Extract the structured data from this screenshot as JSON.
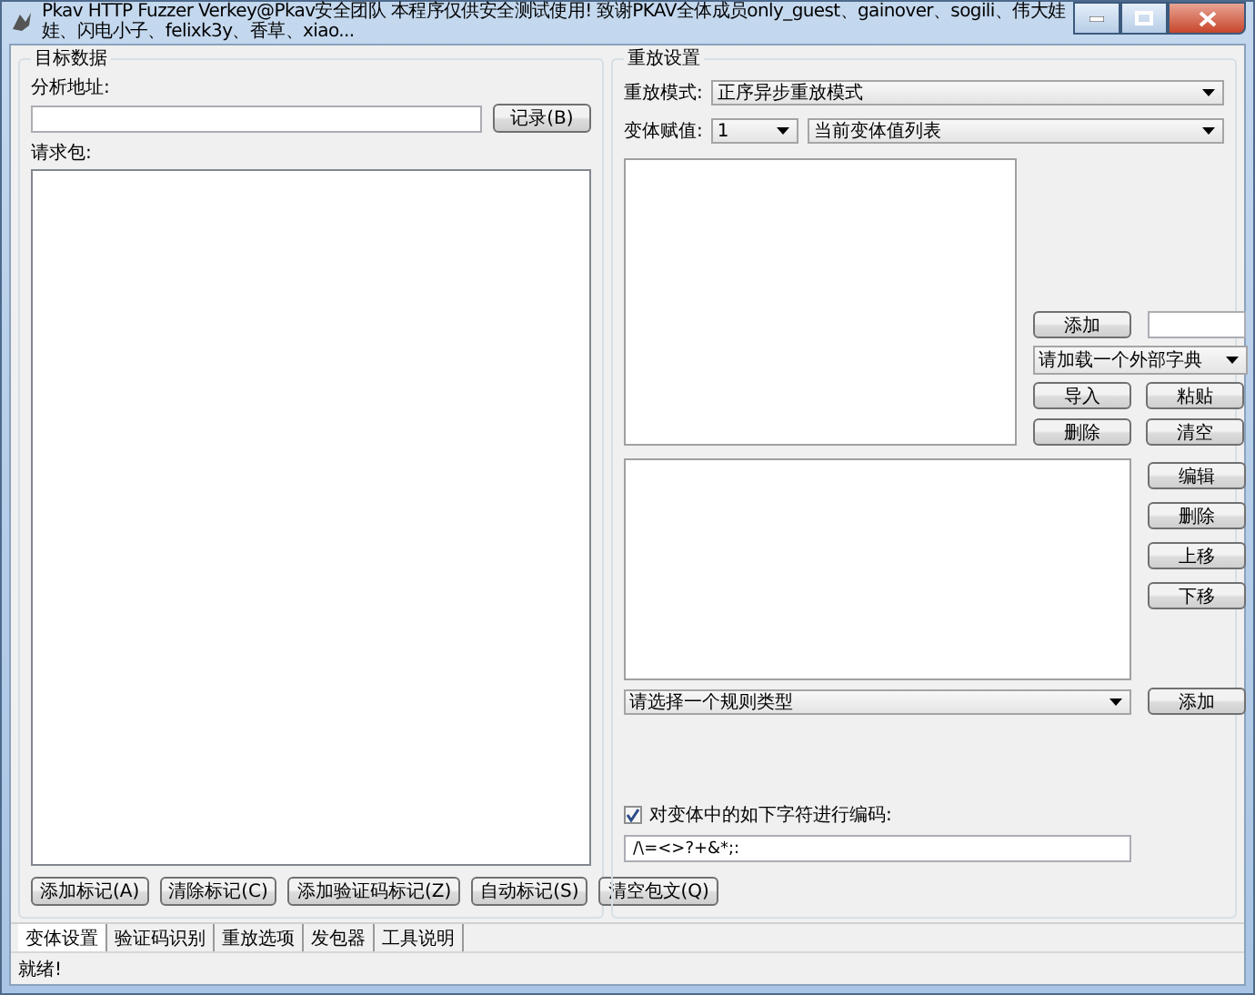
{
  "window": {
    "title": "Pkav HTTP Fuzzer   Verkey@Pkav安全团队  本程序仅供安全测试使用! 致谢PKAV全体成员only_guest、gainover、sogili、伟大娃娃、闪电小子、felixk3y、香草、xiao..."
  },
  "target": {
    "title": "目标数据",
    "url_label": "分析地址:",
    "record_button": "记录(B)",
    "request_label": "请求包:",
    "buttons": [
      "添加标记(A)",
      "清除标记(C)",
      "添加验证码标记(Z)",
      "自动标记(S)",
      "清空包文(Q)"
    ]
  },
  "replay": {
    "title": "重放设置",
    "mode_label": "重放模式:",
    "mode_value": "正序异步重放模式",
    "assign_label": "变体赋值:",
    "assign_value": "1",
    "list_value": "当前变体值列表",
    "add_button": "添加",
    "dict_value": "请加载一个外部字典",
    "value_buttons": [
      "导入",
      "粘贴",
      "删除",
      "清空"
    ],
    "rule_buttons": [
      "编辑",
      "删除",
      "上移",
      "下移"
    ],
    "rule_value": "请选择一个规则类型",
    "rule_add_button": "添加",
    "encode": {
      "label": "对变体中的如下字符进行编码:",
      "checked": true,
      "value": "/\\=<>?+&*;:"
    }
  },
  "tabs": [
    {
      "label": "变体设置",
      "selected": true
    },
    {
      "label": "验证码识别",
      "selected": false
    },
    {
      "label": "重放选项",
      "selected": false
    },
    {
      "label": "发包器",
      "selected": false
    },
    {
      "label": "工具说明",
      "selected": false
    }
  ],
  "status_bar": "就绪!"
}
